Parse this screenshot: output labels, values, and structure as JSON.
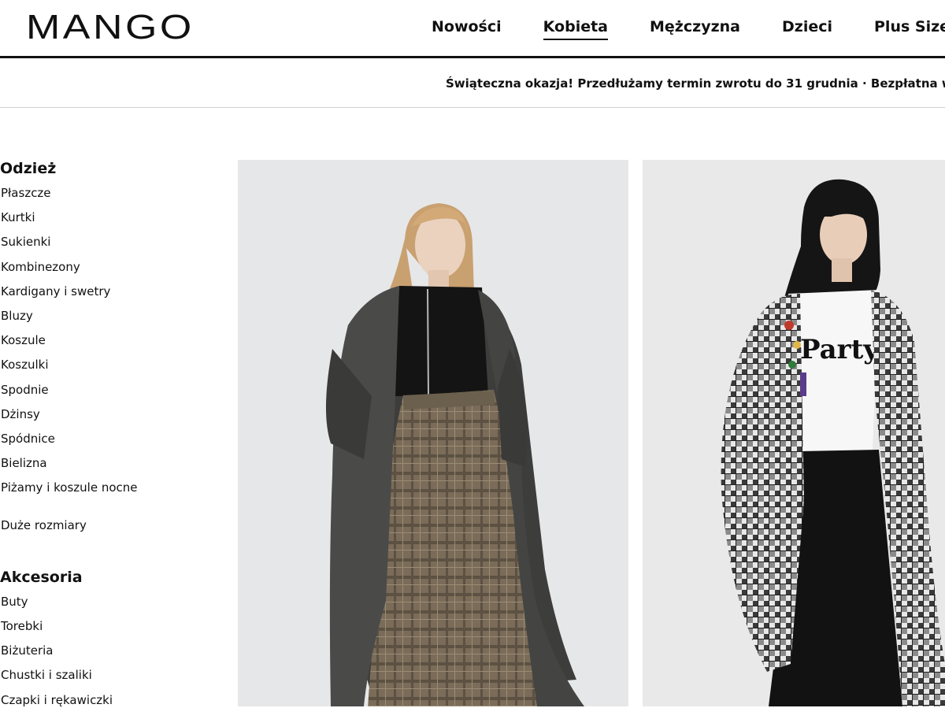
{
  "header": {
    "logo": "MANGO",
    "nav": [
      {
        "label": "Nowości",
        "active": false
      },
      {
        "label": "Kobieta",
        "active": true
      },
      {
        "label": "Mężczyzna",
        "active": false
      },
      {
        "label": "Dzieci",
        "active": false
      },
      {
        "label": "Plus Size",
        "active": false
      }
    ]
  },
  "promo": {
    "text": "Świąteczna okazja! Przedłużamy termin zwrotu do 31 grudnia · Bezpłatna wysyłka o"
  },
  "sidebar": {
    "clothing": {
      "title": "Odzież",
      "items": [
        "Płaszcze",
        "Kurtki",
        "Sukienki",
        "Kombinezony",
        "Kardigany i swetry",
        "Bluzy",
        "Koszule",
        "Koszulki",
        "Spodnie",
        "Dżinsy",
        "Spódnice",
        "Bielizna",
        "Piżamy i koszule nocne"
      ],
      "extra": "Duże rozmiary"
    },
    "accessories": {
      "title": "Akcesoria",
      "items": [
        "Buty",
        "Torebki",
        "Biżuteria",
        "Chustki i szaliki",
        "Czapki i rękawiczki"
      ]
    }
  },
  "products": [
    {
      "image": "woman-grey-wrap-coat-checked-trousers"
    },
    {
      "image": "woman-houndstooth-check-coat-party-tshirt",
      "shirt_text": "Party"
    }
  ],
  "colors": {
    "text": "#111111",
    "image_bg": "#e6e7e9",
    "divider": "#cfcfcf"
  }
}
